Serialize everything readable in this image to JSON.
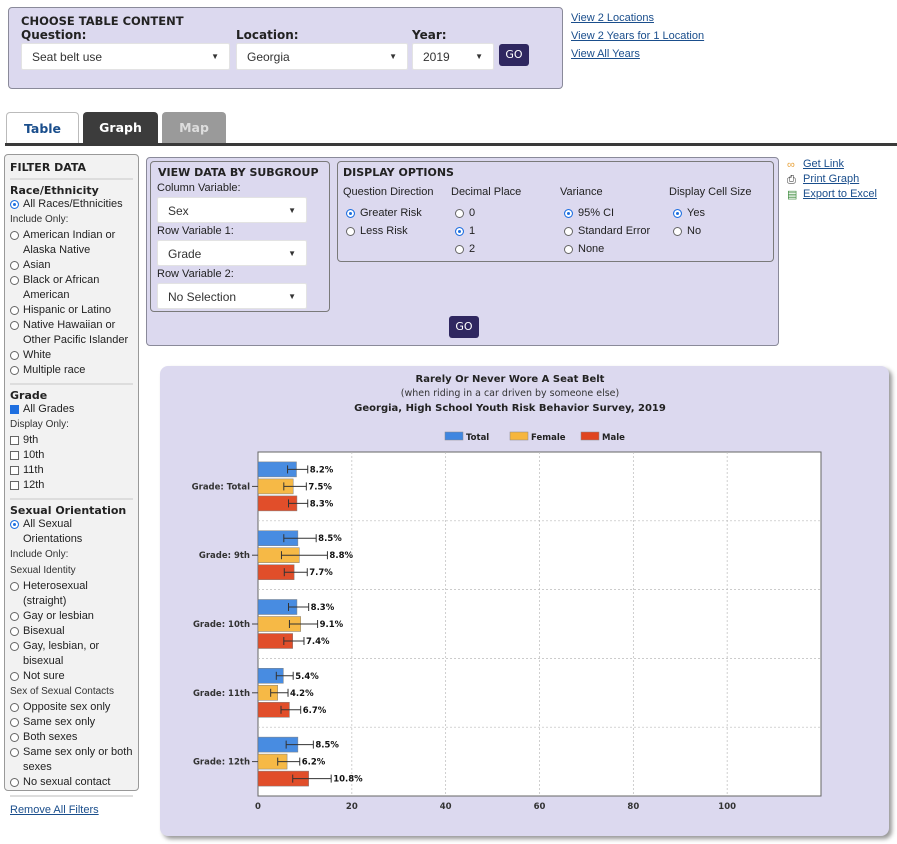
{
  "choose": {
    "title": "CHOOSE TABLE CONTENT",
    "question_label": "Question:",
    "question_value": "Seat belt use",
    "location_label": "Location:",
    "location_value": "Georgia",
    "year_label": "Year:",
    "year_value": "2019",
    "go_label": "GO"
  },
  "links": [
    "View 2 Locations",
    "View 2 Years for 1 Location",
    "View All Years"
  ],
  "tabs": [
    "Table",
    "Graph",
    "Map"
  ],
  "filter": {
    "title": "FILTER DATA",
    "race": {
      "title": "Race/Ethnicity",
      "all": "All Races/Ethnicities",
      "include_only": "Include Only:",
      "options": [
        "American Indian or Alaska Native",
        "Asian",
        "Black or African American",
        "Hispanic or Latino",
        "Native Hawaiian or Other Pacific Islander",
        "White",
        "Multiple race"
      ]
    },
    "grade": {
      "title": "Grade",
      "all": "All Grades",
      "display_only": "Display Only:",
      "options": [
        "9th",
        "10th",
        "11th",
        "12th"
      ]
    },
    "orientation": {
      "title": "Sexual Orientation",
      "all": "All Sexual Orientations",
      "include_only": "Include Only:",
      "identity_label": "Sexual Identity",
      "identity_options": [
        "Heterosexual (straight)",
        "Gay or lesbian",
        "Bisexual",
        "Gay, lesbian, or bisexual",
        "Not sure"
      ],
      "contacts_label": "Sex of Sexual Contacts",
      "contacts_options": [
        "Opposite sex only",
        "Same sex only",
        "Both sexes",
        "Same sex only or both sexes",
        "No sexual contact"
      ]
    },
    "remove_all": "Remove All Filters"
  },
  "subgroup": {
    "title": "VIEW DATA BY SUBGROUP",
    "column_label": "Column Variable:",
    "column_value": "Sex",
    "row1_label": "Row Variable 1:",
    "row1_value": "Grade",
    "row2_label": "Row Variable 2:",
    "row2_value": "No Selection",
    "go_label": "GO"
  },
  "display": {
    "title": "DISPLAY OPTIONS",
    "direction_label": "Question Direction",
    "direction_options": [
      "Greater Risk",
      "Less Risk"
    ],
    "decimal_label": "Decimal Place",
    "decimal_options": [
      "0",
      "1",
      "2"
    ],
    "variance_label": "Variance",
    "variance_options": [
      "95% CI",
      "Standard Error",
      "None"
    ],
    "cellsize_label": "Display Cell Size",
    "cellsize_options": [
      "Yes",
      "No"
    ]
  },
  "tools": [
    "Get Link",
    "Print Graph",
    "Export to Excel"
  ],
  "chart_data": {
    "type": "bar",
    "orientation": "horizontal",
    "title": "Rarely Or Never Wore A Seat Belt",
    "subtitle": "(when riding in a car driven by someone else)",
    "caption": "Georgia, High School Youth Risk Behavior Survey, 2019",
    "categories": [
      "Grade: Total",
      "Grade: 9th",
      "Grade: 10th",
      "Grade: 11th",
      "Grade: 12th"
    ],
    "series": [
      {
        "name": "Total",
        "color": "#3f86e0",
        "values": [
          8.2,
          8.5,
          8.3,
          5.4,
          8.5
        ],
        "ci_low": [
          6.3,
          5.5,
          6.5,
          3.9,
          6.0
        ],
        "ci_high": [
          10.6,
          12.4,
          10.8,
          7.5,
          11.8
        ]
      },
      {
        "name": "Female",
        "color": "#f6b63d",
        "values": [
          7.5,
          8.8,
          9.1,
          4.2,
          6.2
        ],
        "ci_low": [
          5.5,
          5.0,
          6.7,
          2.7,
          4.2
        ],
        "ci_high": [
          10.3,
          14.8,
          12.7,
          6.4,
          8.9
        ]
      },
      {
        "name": "Male",
        "color": "#e0451f",
        "values": [
          8.3,
          7.7,
          7.4,
          6.7,
          10.8
        ],
        "ci_low": [
          6.5,
          5.6,
          5.5,
          4.9,
          7.4
        ],
        "ci_high": [
          10.6,
          10.5,
          9.8,
          9.1,
          15.6
        ]
      }
    ],
    "labels": [
      [
        "8.2%",
        "7.5%",
        "8.3%"
      ],
      [
        "8.5%",
        "8.8%",
        "7.7%"
      ],
      [
        "8.3%",
        "9.1%",
        "7.4%"
      ],
      [
        "5.4%",
        "4.2%",
        "6.7%"
      ],
      [
        "8.5%",
        "6.2%",
        "10.8%"
      ]
    ],
    "xlim": [
      0,
      120
    ],
    "xticks": [
      0,
      20,
      40,
      60,
      80,
      100
    ],
    "legend": "top-center",
    "grid": true
  }
}
